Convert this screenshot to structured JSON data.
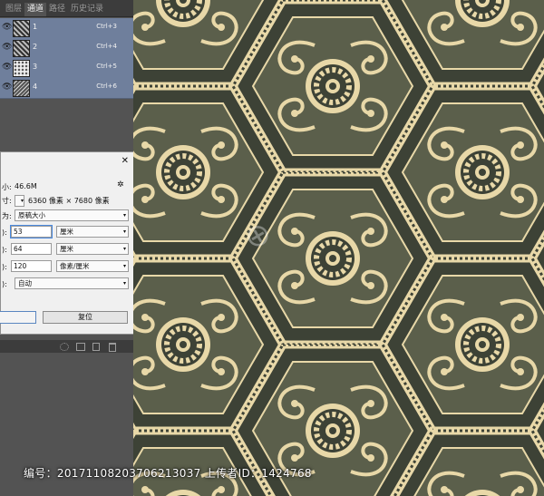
{
  "channels_panel": {
    "tabs": [
      "图层",
      "通道",
      "路径",
      "历史记录"
    ],
    "active_tab": 1,
    "channels": [
      {
        "name": "1",
        "shortcut": "Ctrl+3",
        "thumb": "pattern"
      },
      {
        "name": "2",
        "shortcut": "Ctrl+4",
        "thumb": "pattern"
      },
      {
        "name": "3",
        "shortcut": "Ctrl+5",
        "thumb": "dots"
      },
      {
        "name": "4",
        "shortcut": "Ctrl+6",
        "thumb": "mix"
      }
    ]
  },
  "image_size_dialog": {
    "close_glyph": "✕",
    "size_label": "小:",
    "size_value": "46.6M",
    "dimensions_label": "寸:",
    "dimensions_value": "6360 像素 × 7680 像素",
    "fit_label": "为:",
    "fit_value": "原稿大小",
    "width_label": "):",
    "width_value": "53",
    "width_unit": "厘米",
    "height_label": "):",
    "height_value": "64",
    "height_unit": "厘米",
    "resolution_label": "):",
    "resolution_value": "120",
    "resolution_unit": "像素/厘米",
    "resample_label": "):",
    "resample_value": "自动",
    "reset_button": "复位",
    "gear_glyph": "✲"
  },
  "watermark": {
    "text": "编号：20171108203706213037 上传者ID：1424768",
    "stamp_glyph": "⊕"
  },
  "colors": {
    "pattern_dark": "#3d4236",
    "pattern_cream": "#e8d8a8",
    "pattern_olive": "#5b5f4b",
    "panel_bg": "#535353",
    "selected_row": "#6f7f9c"
  }
}
